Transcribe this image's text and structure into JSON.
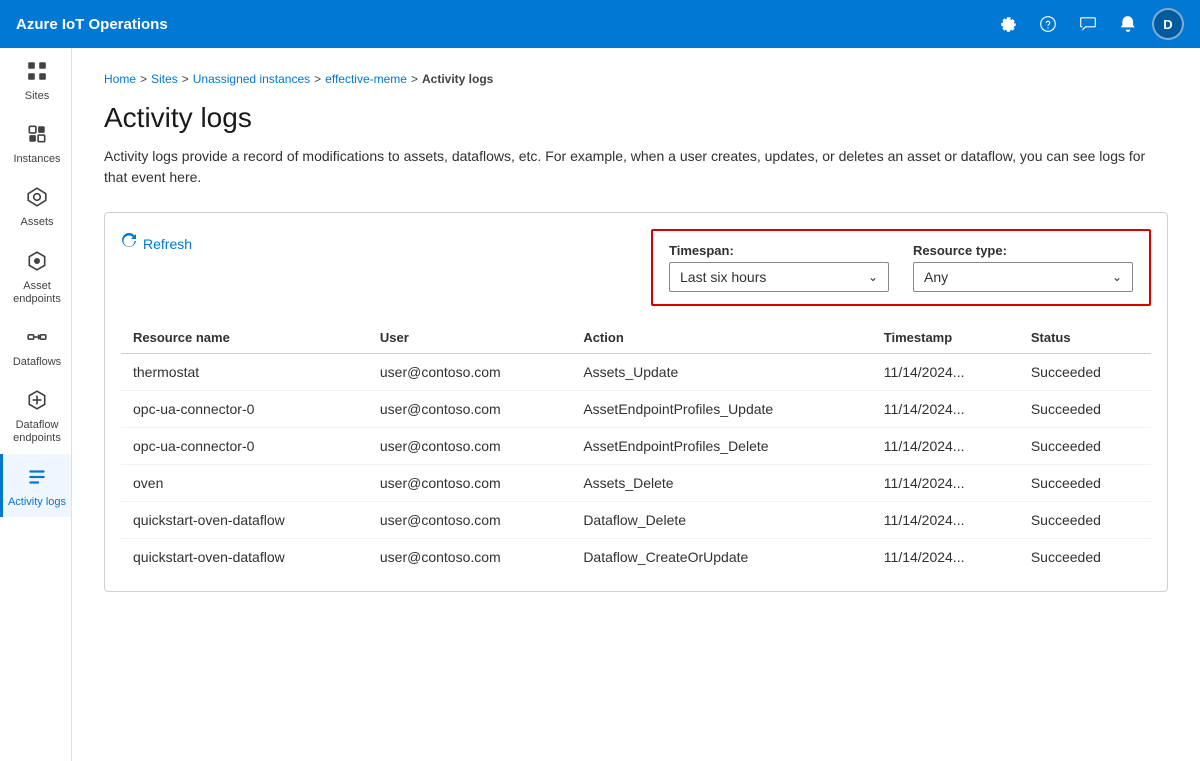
{
  "app": {
    "title": "Azure IoT Operations"
  },
  "nav_icons": [
    {
      "name": "settings-icon",
      "symbol": "⚙"
    },
    {
      "name": "help-icon",
      "symbol": "?"
    },
    {
      "name": "feedback-icon",
      "symbol": "🔔"
    },
    {
      "name": "notification-icon",
      "symbol": "🔔"
    }
  ],
  "avatar": {
    "label": "D"
  },
  "sidebar": {
    "items": [
      {
        "id": "sites",
        "label": "Sites",
        "icon": "▦",
        "active": false
      },
      {
        "id": "instances",
        "label": "Instances",
        "icon": "⊞",
        "active": false
      },
      {
        "id": "assets",
        "label": "Assets",
        "icon": "◈",
        "active": false
      },
      {
        "id": "asset-endpoints",
        "label": "Asset endpoints",
        "icon": "⬡",
        "active": false
      },
      {
        "id": "dataflows",
        "label": "Dataflows",
        "icon": "⇌",
        "active": false
      },
      {
        "id": "dataflow-endpoints",
        "label": "Dataflow endpoints",
        "icon": "⬡",
        "active": false
      },
      {
        "id": "activity-logs",
        "label": "Activity logs",
        "icon": "≡",
        "active": true
      }
    ]
  },
  "breadcrumb": {
    "items": [
      {
        "label": "Home",
        "link": true
      },
      {
        "label": "Sites",
        "link": true
      },
      {
        "label": "Unassigned instances",
        "link": true
      },
      {
        "label": "effective-meme",
        "link": true
      },
      {
        "label": "Activity logs",
        "link": false
      }
    ]
  },
  "page": {
    "title": "Activity logs",
    "description": "Activity logs provide a record of modifications to assets, dataflows, etc. For example, when a user creates, updates, or deletes an asset or dataflow, you can see logs for that event here.",
    "description_link": "here."
  },
  "toolbar": {
    "refresh_label": "Refresh",
    "timespan_label": "Timespan:",
    "timespan_value": "Last six hours",
    "resource_type_label": "Resource type:",
    "resource_type_value": "Any"
  },
  "table": {
    "columns": [
      "Resource name",
      "User",
      "Action",
      "Timestamp",
      "Status"
    ],
    "rows": [
      {
        "resource_name": "thermostat",
        "user": "user@contoso.com",
        "action": "Assets_Update",
        "timestamp": "11/14/2024...",
        "status": "Succeeded",
        "resource_link": true,
        "action_link": false
      },
      {
        "resource_name": "opc-ua-connector-0",
        "user": "user@contoso.com",
        "action": "AssetEndpointProfiles_Update",
        "timestamp": "11/14/2024...",
        "status": "Succeeded",
        "resource_link": true,
        "action_link": false
      },
      {
        "resource_name": "opc-ua-connector-0",
        "user": "user@contoso.com",
        "action": "AssetEndpointProfiles_Delete",
        "timestamp": "11/14/2024...",
        "status": "Succeeded",
        "resource_link": true,
        "action_link": false
      },
      {
        "resource_name": "oven",
        "user": "user@contoso.com",
        "action": "Assets_Delete",
        "timestamp": "11/14/2024...",
        "status": "Succeeded",
        "resource_link": true,
        "action_link": false
      },
      {
        "resource_name": "quickstart-oven-dataflow",
        "user": "user@contoso.com",
        "action": "Dataflow_Delete",
        "timestamp": "11/14/2024...",
        "status": "Succeeded",
        "resource_link": true,
        "action_link": true
      },
      {
        "resource_name": "quickstart-oven-dataflow",
        "user": "user@contoso.com",
        "action": "Dataflow_CreateOrUpdate",
        "timestamp": "11/14/2024...",
        "status": "Succeeded",
        "resource_link": true,
        "action_link": true
      }
    ]
  }
}
